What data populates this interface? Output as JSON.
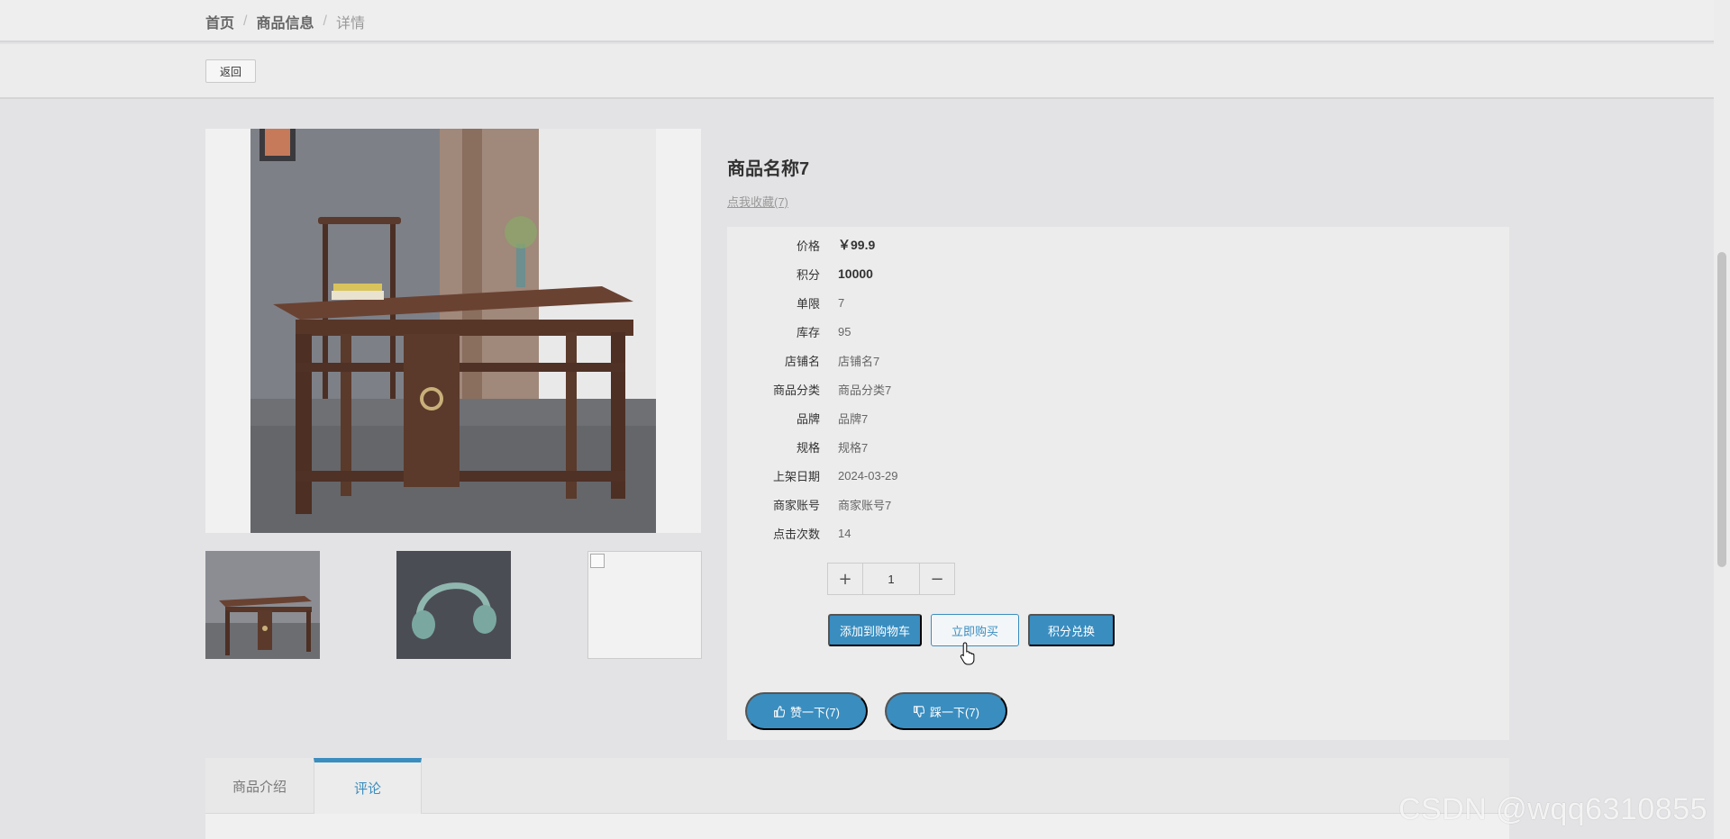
{
  "breadcrumb": {
    "home": "首页",
    "category": "商品信息",
    "current": "详情",
    "separator": "/"
  },
  "back_label": "返回",
  "product": {
    "title": "商品名称7",
    "favorite_link": "点我收藏(7)",
    "details": [
      {
        "label": "价格",
        "value": "￥99.9",
        "emphasis": true
      },
      {
        "label": "积分",
        "value": "10000",
        "emphasis": true
      },
      {
        "label": "单限",
        "value": "7",
        "emphasis": false
      },
      {
        "label": "库存",
        "value": "95",
        "emphasis": false
      },
      {
        "label": "店铺名",
        "value": "店铺名7",
        "emphasis": false
      },
      {
        "label": "商品分类",
        "value": "商品分类7",
        "emphasis": false
      },
      {
        "label": "品牌",
        "value": "品牌7",
        "emphasis": false
      },
      {
        "label": "规格",
        "value": "规格7",
        "emphasis": false
      },
      {
        "label": "上架日期",
        "value": "2024-03-29",
        "emphasis": false
      },
      {
        "label": "商家账号",
        "value": "商家账号7",
        "emphasis": false
      },
      {
        "label": "点击次数",
        "value": "14",
        "emphasis": false
      }
    ]
  },
  "quantity": {
    "plus": "+",
    "value": "1",
    "minus": "−"
  },
  "actions": {
    "add_to_cart": "添加到购物车",
    "buy_now": "立即购买",
    "points_exchange": "积分兑换"
  },
  "votes": {
    "like": "赞一下(7)",
    "dislike": "踩一下(7)"
  },
  "tabs": {
    "intro": "商品介绍",
    "comments": "评论",
    "active": "comments"
  },
  "watermark": "CSDN @wqq6310855",
  "colors": {
    "accent": "#3a8dbf",
    "background": "#e3e3e5"
  },
  "icons": {
    "like": "thumbs-up-icon",
    "dislike": "thumbs-down-icon"
  }
}
